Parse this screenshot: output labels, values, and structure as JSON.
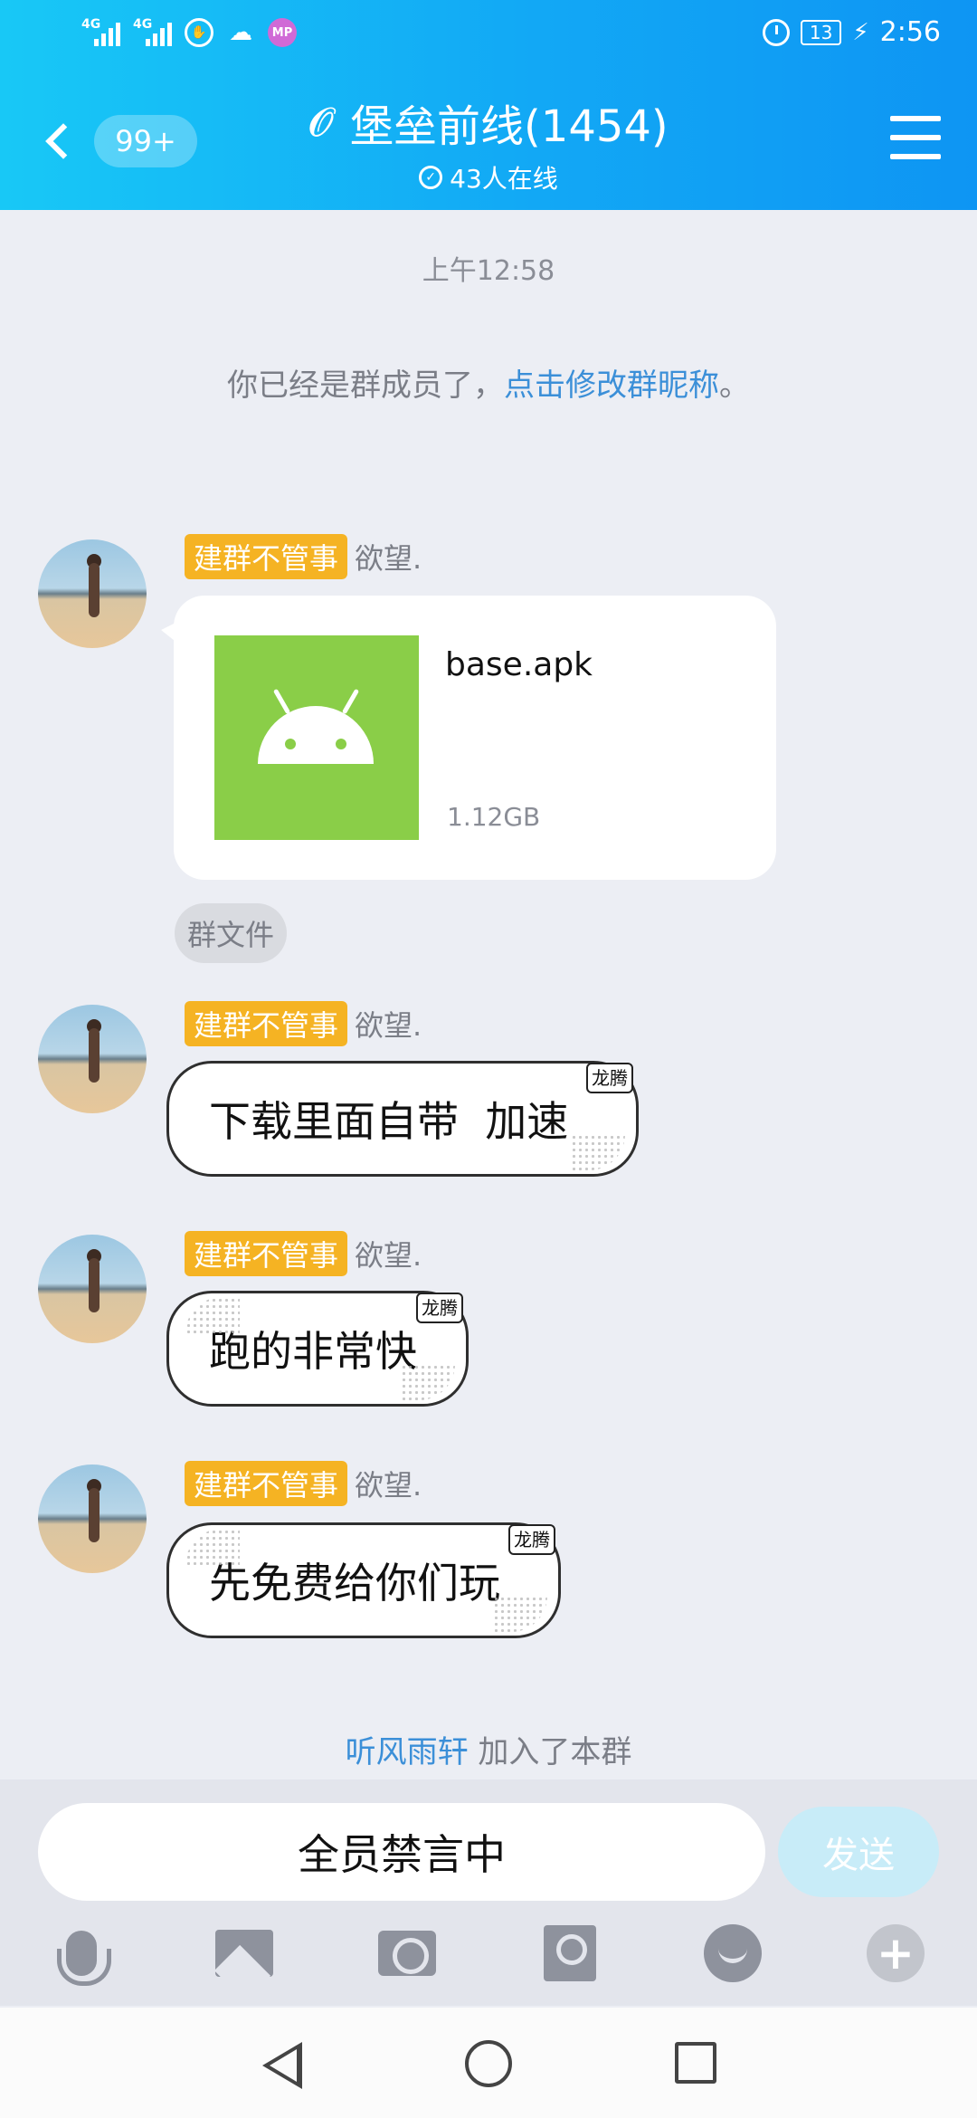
{
  "status_bar": {
    "net1": "4G",
    "net2": "4G",
    "battery": "13",
    "time": "2:56"
  },
  "header": {
    "unread_badge": "99+",
    "title": "堡垒前线(1454)",
    "online": "43人在线",
    "ear_icon": "ear-icon",
    "menu_icon": "hamburger-icon"
  },
  "chat": {
    "timestamp": "上午12:58",
    "system_notice": {
      "text": "你已经是群成员了，",
      "link": "点击修改群昵称",
      "suffix": "。"
    },
    "messages": [
      {
        "tag": "建群不管事",
        "nick": "欲望.",
        "type": "file",
        "file_name": "base.apk",
        "file_size": "1.12GB",
        "file_label": "群文件"
      },
      {
        "tag": "建群不管事",
        "nick": "欲望.",
        "type": "text",
        "text": "下载里面自带  加速",
        "badge": "龙腾"
      },
      {
        "tag": "建群不管事",
        "nick": "欲望.",
        "type": "text",
        "text": "跑的非常快",
        "badge": "龙腾"
      },
      {
        "tag": "建群不管事",
        "nick": "欲望.",
        "type": "text",
        "text": "先免费给你们玩",
        "badge": "龙腾"
      }
    ],
    "join_notice": {
      "who": "听风雨轩",
      "text": " 加入了本群"
    }
  },
  "input": {
    "muted_text": "全员禁言中",
    "send_label": "发送"
  },
  "toolbar_icons": [
    "microphone-icon",
    "image-icon",
    "camera-icon",
    "red-packet-icon",
    "emoji-icon",
    "plus-icon"
  ],
  "colors": {
    "header_start": "#18c8f6",
    "header_end": "#0e95f3",
    "tag": "#f5b323",
    "link": "#3b8fd8",
    "apk_green": "#8ace48"
  }
}
